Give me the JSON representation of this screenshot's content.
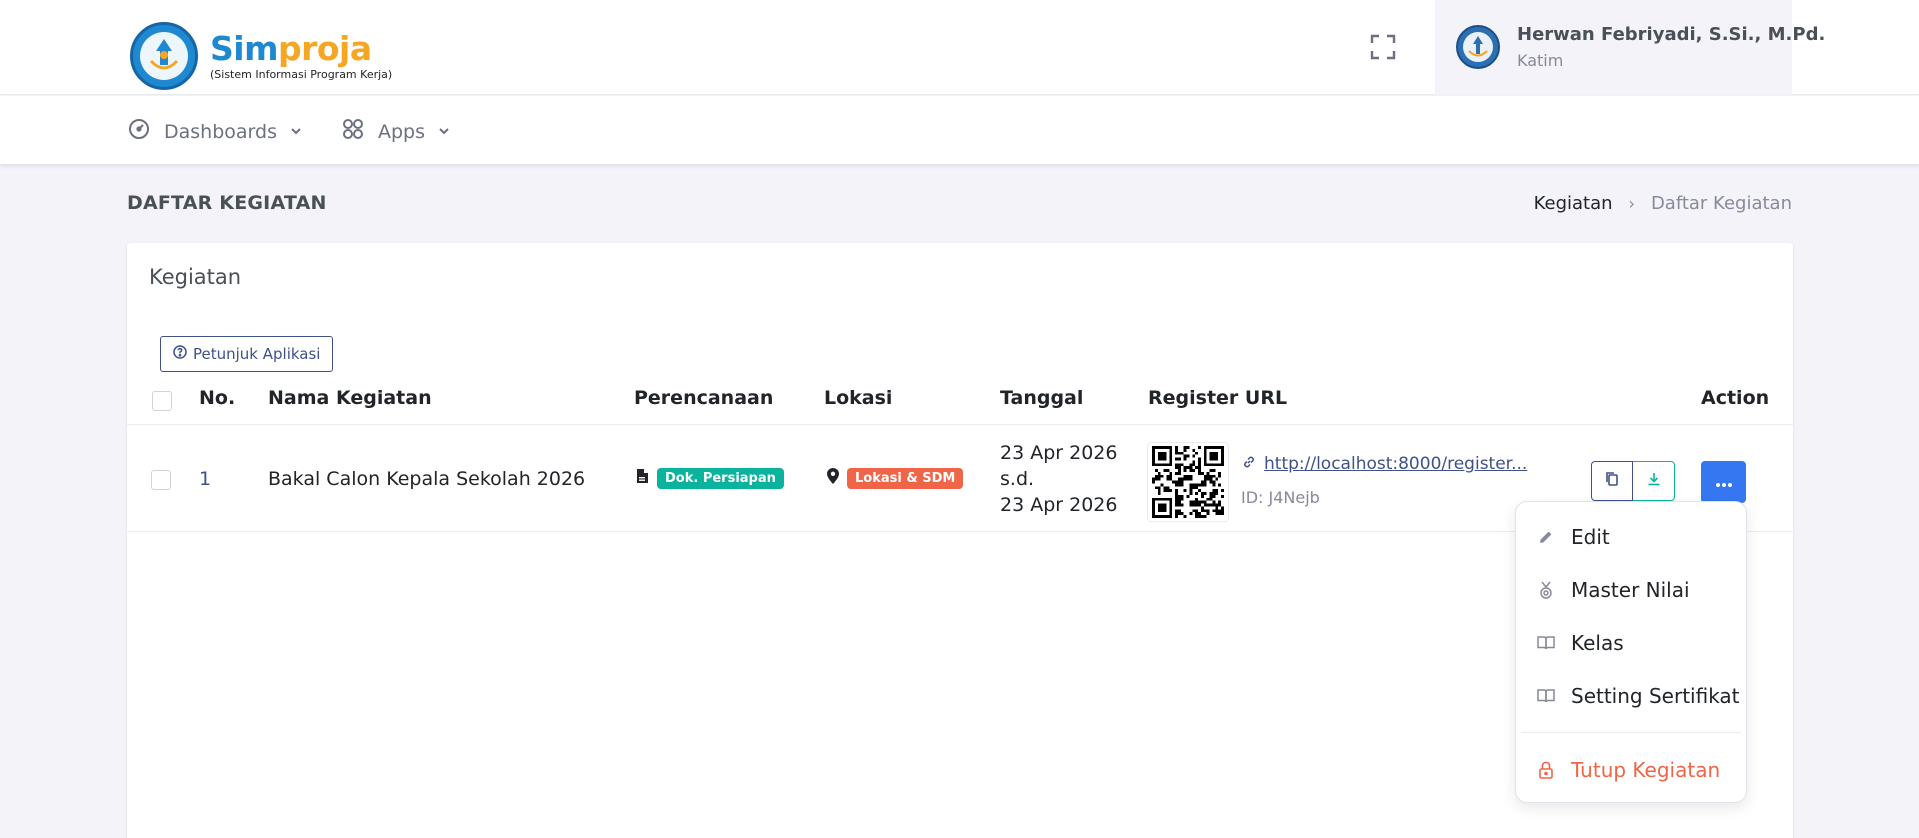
{
  "header": {
    "brand_part1": "Sim",
    "brand_part2": "proja",
    "brand_subtitle": "(Sistem Informasi Program Kerja)",
    "user_name": "Herwan Febriyadi, S.Si., M.Pd.",
    "user_role": "Katim",
    "icons": {
      "fullscreen": "fullscreen-icon"
    }
  },
  "nav": {
    "items": [
      {
        "label": "Dashboards",
        "icon": "dashboard-gauge-icon"
      },
      {
        "label": "Apps",
        "icon": "apps-grid-icon"
      }
    ]
  },
  "page": {
    "title": "DAFTAR KEGIATAN",
    "breadcrumb": [
      "Kegiatan",
      "Daftar Kegiatan"
    ]
  },
  "card": {
    "title": "Kegiatan",
    "guide_button": "Petunjuk Aplikasi"
  },
  "table": {
    "columns": [
      "No.",
      "Nama Kegiatan",
      "Perencanaan",
      "Lokasi",
      "Tanggal",
      "Register URL",
      "Action"
    ],
    "rows": [
      {
        "no": "1",
        "nama": "Bakal Calon Kepala Sekolah 2026",
        "perencanaan": "Dok. Persiapan",
        "lokasi": "Lokasi & SDM",
        "tanggal_start": "23 Apr 2026",
        "tanggal_sep": "s.d.",
        "tanggal_end": "23 Apr 2026",
        "register_url": "http://localhost:8000/register...",
        "register_id": "ID: J4Nejb"
      }
    ]
  },
  "dropdown": {
    "items": [
      {
        "label": "Edit",
        "icon": "pencil-icon"
      },
      {
        "label": "Master Nilai",
        "icon": "medal-icon"
      },
      {
        "label": "Kelas",
        "icon": "book-open-icon"
      },
      {
        "label": "Setting Sertifikat",
        "icon": "book-open-icon"
      }
    ],
    "danger_item": {
      "label": "Tutup Kegiatan",
      "icon": "lock-icon"
    }
  },
  "colors": {
    "primary": "#405189",
    "success": "#0ab39c",
    "danger": "#f06548",
    "info_blue": "#3577f1",
    "brand_blue": "#1e88d0",
    "brand_orange": "#f5a623"
  }
}
